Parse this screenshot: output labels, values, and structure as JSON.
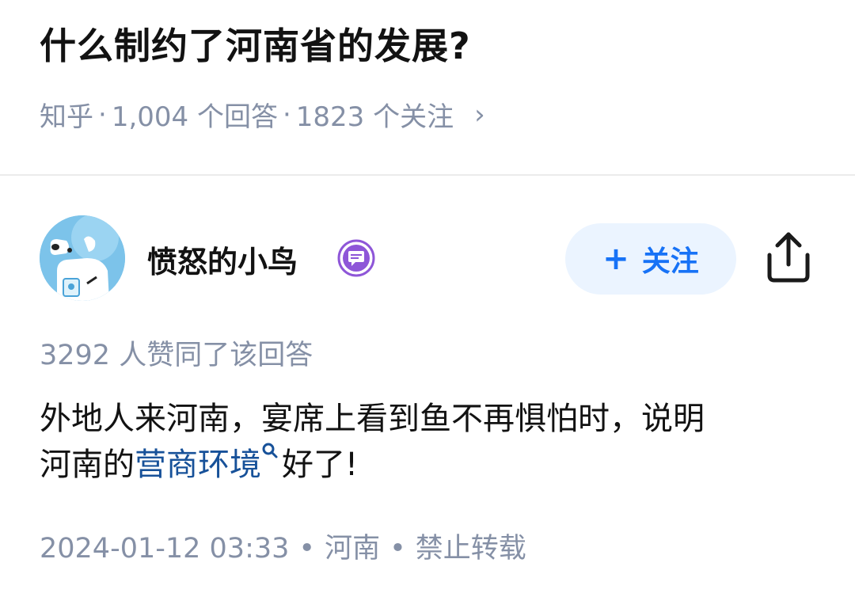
{
  "question": {
    "title": "什么制约了河南省的发展?",
    "source": "知乎",
    "answers": "1,004 个回答",
    "followers": "1823 个关注",
    "chevron": "›"
  },
  "author": {
    "name": "愤怒的小鸟",
    "avatar_icon": "cartoon-dog-avatar",
    "badge_icon": "chat-bubble-badge-icon",
    "badge_color": "#8e56d8"
  },
  "follow_button": {
    "plus": "+",
    "label": "关注"
  },
  "share_icon": "share-upload-icon",
  "answer": {
    "likes": "3292 人赞同了该回答",
    "line1": "外地人来河南，宴席上看到鱼不再惧怕时，说明",
    "line2_prefix": "河南的",
    "line2_link": "营商环境",
    "line2_suffix": "好了!",
    "date": "2024-01-12 03:33",
    "location": "河南",
    "rights": "禁止转载",
    "dot": "•"
  },
  "colors": {
    "accent": "#1772f6",
    "link": "#175199",
    "meta": "#8590a6",
    "follow_bg": "#ebf4ff"
  }
}
